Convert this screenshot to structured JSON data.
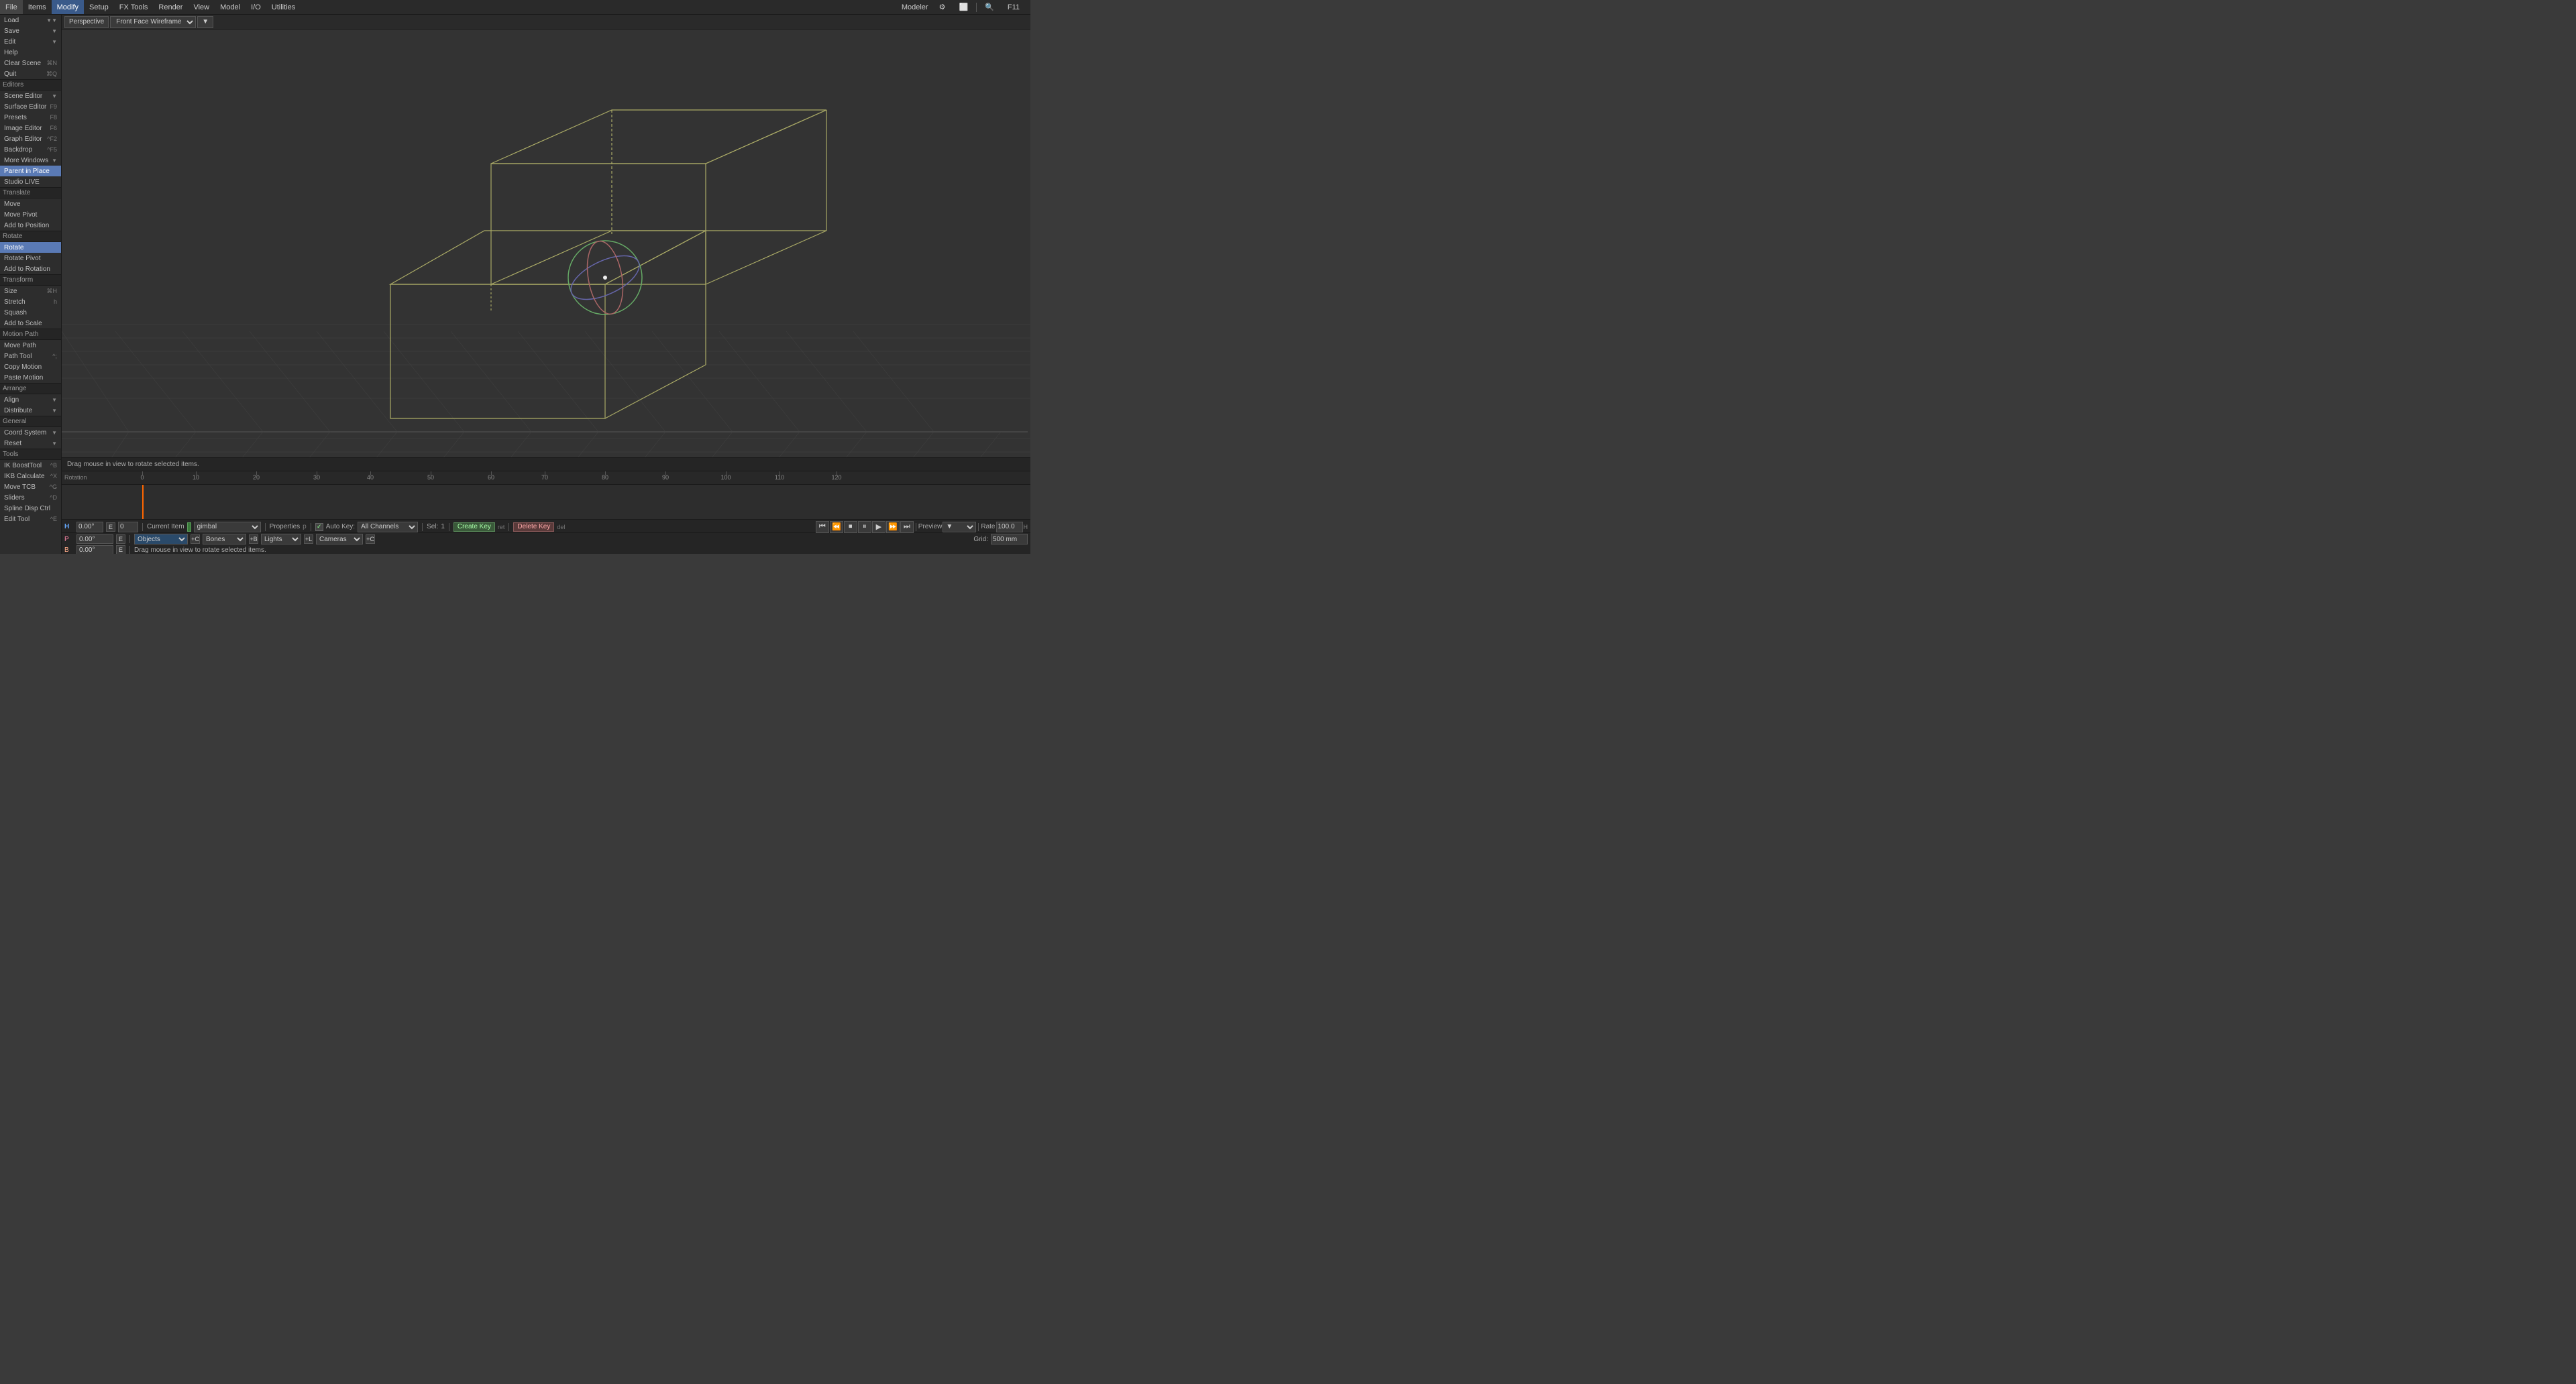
{
  "app": {
    "title": "Modeler",
    "mode": "F11"
  },
  "menubar": {
    "items": [
      "File",
      "Items",
      "Modify",
      "Setup",
      "FX Tools",
      "Render",
      "View",
      "Model",
      "I/O",
      "Utilities"
    ],
    "active": "Modify"
  },
  "viewport": {
    "camera_label": "Perspective",
    "shading_label": "Front Face Wireframe",
    "status_text": "Drag mouse in view to rotate selected items."
  },
  "left_panel": {
    "file_items": [
      {
        "label": "Load",
        "shortcut": ""
      },
      {
        "label": "Save",
        "shortcut": ""
      },
      {
        "label": "Edit",
        "shortcut": ""
      },
      {
        "label": "Help",
        "shortcut": ""
      }
    ],
    "sections": [
      {
        "header": "",
        "items": [
          {
            "label": "Clear Scene",
            "shortcut": "⌘N",
            "active": false
          },
          {
            "label": "Quit",
            "shortcut": "⌘Q",
            "active": false
          }
        ]
      },
      {
        "header": "Editors",
        "items": [
          {
            "label": "Scene Editor",
            "shortcut": "",
            "arrow": true,
            "active": false
          },
          {
            "label": "Surface Editor",
            "shortcut": "F5",
            "active": false
          },
          {
            "label": "Presets",
            "shortcut": "F8",
            "active": false
          },
          {
            "label": "Image Editor",
            "shortcut": "F6",
            "active": false
          },
          {
            "label": "Graph Editor",
            "shortcut": "^F2",
            "active": false
          },
          {
            "label": "Backdrop",
            "shortcut": "^F5",
            "active": false
          },
          {
            "label": "More Windows",
            "shortcut": "",
            "arrow": true,
            "active": false
          },
          {
            "label": "Parent in Place",
            "shortcut": "",
            "active": true
          },
          {
            "label": "Studio LIVE",
            "shortcut": "",
            "active": false
          }
        ]
      },
      {
        "header": "Translate",
        "items": [
          {
            "label": "Move",
            "shortcut": "",
            "active": false
          },
          {
            "label": "Move Pivot",
            "shortcut": "",
            "active": false
          },
          {
            "label": "Add to Position",
            "shortcut": "",
            "active": false
          }
        ]
      },
      {
        "header": "Rotate",
        "items": [
          {
            "label": "Rotate",
            "shortcut": "",
            "active": true
          },
          {
            "label": "Rotate Pivot",
            "shortcut": "",
            "active": false
          },
          {
            "label": "Add to Rotation",
            "shortcut": "",
            "active": false
          }
        ]
      },
      {
        "header": "Transform",
        "items": [
          {
            "label": "Size",
            "shortcut": "⌘H",
            "active": false
          },
          {
            "label": "Stretch",
            "shortcut": "h",
            "active": false
          },
          {
            "label": "Squash",
            "shortcut": "",
            "active": false
          },
          {
            "label": "Add to Scale",
            "shortcut": "",
            "active": false
          }
        ]
      },
      {
        "header": "Motion Path",
        "items": [
          {
            "label": "Move Path",
            "shortcut": "",
            "active": false
          },
          {
            "label": "Path Tool",
            "shortcut": "^;",
            "active": false
          },
          {
            "label": "Copy Motion",
            "shortcut": "",
            "active": false
          },
          {
            "label": "Paste Motion",
            "shortcut": "",
            "active": false
          }
        ]
      },
      {
        "header": "Arrange",
        "items": [
          {
            "label": "Align",
            "shortcut": "",
            "arrow": true,
            "active": false
          },
          {
            "label": "Distribute",
            "shortcut": "",
            "arrow": true,
            "active": false
          }
        ]
      },
      {
        "header": "General",
        "items": [
          {
            "label": "Coord System",
            "shortcut": "",
            "arrow": true,
            "active": false
          },
          {
            "label": "Reset",
            "shortcut": "",
            "arrow": true,
            "active": false
          }
        ]
      },
      {
        "header": "Tools",
        "items": [
          {
            "label": "IK BoostTool",
            "shortcut": "^B",
            "active": false
          },
          {
            "label": "IKB Calculate",
            "shortcut": "^X",
            "active": false
          },
          {
            "label": "Move TCB",
            "shortcut": "^G",
            "active": false
          },
          {
            "label": "Sliders",
            "shortcut": "^D",
            "active": false
          },
          {
            "label": "Spline Disp Ctrl",
            "shortcut": "",
            "active": false
          },
          {
            "label": "Edit Tool",
            "shortcut": "^E",
            "active": false
          }
        ]
      }
    ]
  },
  "timeline": {
    "label": "Rotation",
    "ruler_marks": [
      0,
      10,
      20,
      30,
      40,
      50,
      60,
      70,
      80,
      90,
      100,
      110,
      120
    ],
    "playhead_frame": 0
  },
  "bottom_bar": {
    "h_label": "H",
    "p_label": "P",
    "b_label": "B",
    "h_value": "0.00°",
    "p_value": "0.00°",
    "b_value": "0.00°",
    "current_item_label": "Current Item",
    "current_item_value": "gimbal",
    "properties_label": "Properties",
    "properties_shortcut": "p",
    "auto_key_label": "Auto Key:",
    "auto_key_value": "All Channels",
    "objects_label": "Objects",
    "bones_label": "Bones",
    "lights_label": "Lights",
    "cameras_label": "Cameras",
    "sel_label": "Sel:",
    "sel_value": "1",
    "create_key_label": "Create Key",
    "create_key_shortcut": "ret",
    "delete_key_label": "Delete Key",
    "delete_key_shortcut": "del",
    "preview_label": "Preview",
    "rate_label": "Rate",
    "rate_value": "100.0",
    "grid_label": "Grid:",
    "grid_value": "500 mm",
    "frame_display": "0"
  },
  "transport": {
    "buttons": [
      "⏮",
      "⏪",
      "⏹",
      "⏸",
      "▶",
      "⏩",
      "⏭"
    ]
  },
  "icons": {
    "settings": "⚙",
    "expand": "⬜",
    "search": "🔍",
    "checkbox_on": "✓",
    "arrow_down": "▼",
    "arrow_right": "▶"
  }
}
